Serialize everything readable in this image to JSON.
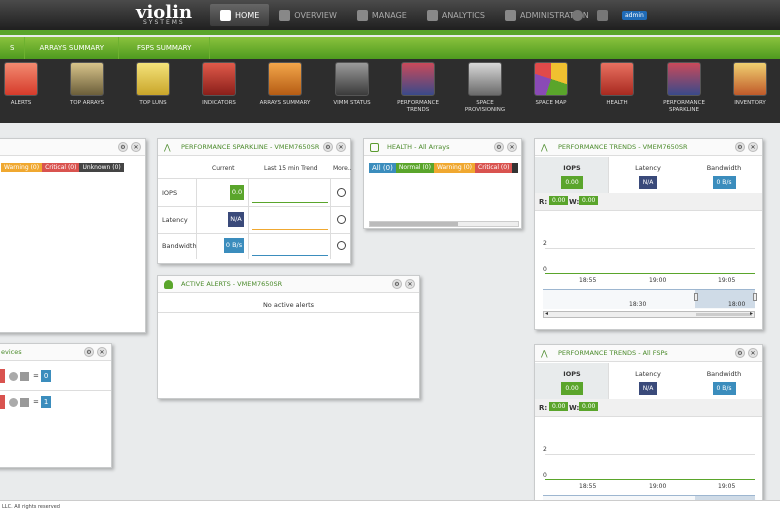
{
  "brand": {
    "logo": "violin",
    "sub": "SYSTEMS"
  },
  "nav": {
    "home": "HOME",
    "overview": "OVERVIEW",
    "manage": "MANAGE",
    "analytics": "ANALYTICS",
    "administration": "ADMINISTRATION",
    "user": "admin"
  },
  "subnav": [
    "S",
    "ARRAYS SUMMARY",
    "FSPS SUMMARY"
  ],
  "toolbar": [
    "ALERTS",
    "TOP ARRAYS",
    "TOP LUNS",
    "INDICATORS",
    "ARRAYS SUMMARY",
    "VIMM STATUS",
    "PERFORMANCE TRENDS",
    "SPACE PROVISIONING",
    "SPACE MAP",
    "HEALTH",
    "PERFORMANCE SPARKLINE",
    "INVENTORY"
  ],
  "left_panel": {
    "warning": "Warning (0)",
    "critical": "Critical (0)",
    "unknown": "Unknown (0)"
  },
  "devices_panel": {
    "title": "evices",
    "row1_value": "0",
    "row2_value": "1"
  },
  "sparkline": {
    "title": "PERFORMANCE SPARKLINE - VMEM7650SR",
    "col_current": "Current",
    "col_trend": "Last 15 min Trend",
    "col_more": "More..",
    "rows": [
      {
        "label": "IOPS",
        "value": "0.0"
      },
      {
        "label": "Latency",
        "value": "N/A"
      },
      {
        "label": "Bandwidth",
        "value": "0 B/s"
      }
    ]
  },
  "health": {
    "title": "HEALTH - All Arrays",
    "all": "All (0)",
    "normal": "Normal (0)",
    "warning": "Warning (0)",
    "critical": "Critical (0)"
  },
  "alerts": {
    "title": "ACTIVE ALERTS - VMEM7650SR",
    "empty": "No active alerts"
  },
  "trends1": {
    "title": "PERFORMANCE TRENDS - VMEM7650SR",
    "iops": "IOPS",
    "iops_val": "0.00",
    "latency": "Latency",
    "latency_val": "N/A",
    "bandwidth": "Bandwidth",
    "bandwidth_val": "0 B/s",
    "r_lbl": "R:",
    "r_val": "0.00",
    "w_lbl": "W:",
    "w_val": "0.00",
    "y2": "2",
    "y0": "0",
    "t1": "18:55",
    "t2": "19:00",
    "t3": "19:05",
    "n1": "18:30",
    "n2": "18:00"
  },
  "trends2": {
    "title": "PERFORMANCE TRENDS - All FSPs",
    "iops": "IOPS",
    "iops_val": "0.00",
    "latency": "Latency",
    "latency_val": "N/A",
    "bandwidth": "Bandwidth",
    "bandwidth_val": "0 B/s",
    "r_lbl": "R:",
    "r_val": "0.00",
    "w_lbl": "W:",
    "w_val": "0.00",
    "y2": "2",
    "y0": "0",
    "t1": "18:55",
    "t2": "19:00",
    "t3": "19:05"
  },
  "footer": "LLC. All rights reserved",
  "colors": {
    "green": "#5aa52b",
    "warning": "#f0a830",
    "critical": "#d9534f",
    "unknown": "#555555",
    "navy": "#3a4a7a",
    "blue": "#3b8dbd",
    "all": "#3b8dbd",
    "normal": "#5aa52b"
  }
}
